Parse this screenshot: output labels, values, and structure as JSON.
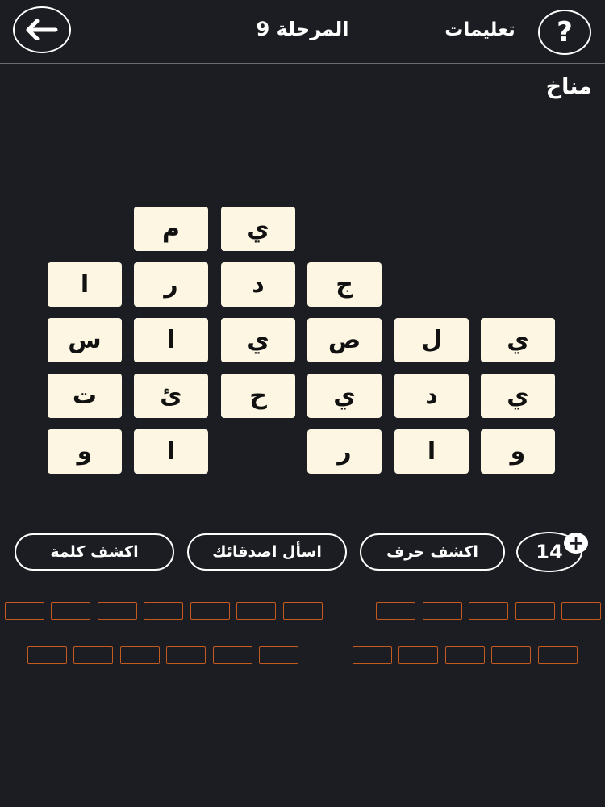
{
  "header": {
    "level_title": "المرحلة 9",
    "instructions_label": "تعليمات",
    "help_symbol": "?"
  },
  "category": "مناخ",
  "grid": {
    "rows": [
      [
        "",
        "",
        "",
        "",
        "م",
        "ي"
      ],
      [
        "",
        "",
        "ج",
        "د",
        "ر",
        "ا"
      ],
      [
        "ي",
        "ل",
        "ص",
        "ي",
        "ا",
        "س"
      ],
      [
        "ي",
        "د",
        "ي",
        "ح",
        "ئ",
        "ت"
      ],
      [
        "و",
        "ا",
        "ر",
        "",
        "ا",
        "و"
      ]
    ]
  },
  "tiles": [
    {
      "letter": "ي"
    },
    {
      "letter": "م"
    },
    {
      "letter": "ج"
    },
    {
      "letter": "د"
    },
    {
      "letter": "ر"
    },
    {
      "letter": "ا"
    },
    {
      "letter": "ي"
    },
    {
      "letter": "ل"
    },
    {
      "letter": "ص"
    },
    {
      "letter": "ي"
    },
    {
      "letter": "ا"
    },
    {
      "letter": "س"
    },
    {
      "letter": "ي"
    },
    {
      "letter": "د"
    },
    {
      "letter": "ي"
    },
    {
      "letter": "ح"
    },
    {
      "letter": "ئ"
    },
    {
      "letter": "ت"
    },
    {
      "letter": "و"
    },
    {
      "letter": "ا"
    },
    {
      "letter": "ر"
    },
    {
      "letter": "ا"
    },
    {
      "letter": "و"
    }
  ],
  "coins": "14",
  "coins_plus": "+",
  "actions": {
    "reveal_letter": "اكشف حرف",
    "ask_friends": "اسأل اصدقائك",
    "reveal_word": "اكشف كلمة"
  },
  "answer_slots": {
    "row1_words": [
      5,
      7
    ],
    "row2_words": [
      5,
      6
    ]
  },
  "colors": {
    "background": "#1c1d22",
    "tile": "#fdf6e3",
    "slot_border": "#c45a1d"
  }
}
